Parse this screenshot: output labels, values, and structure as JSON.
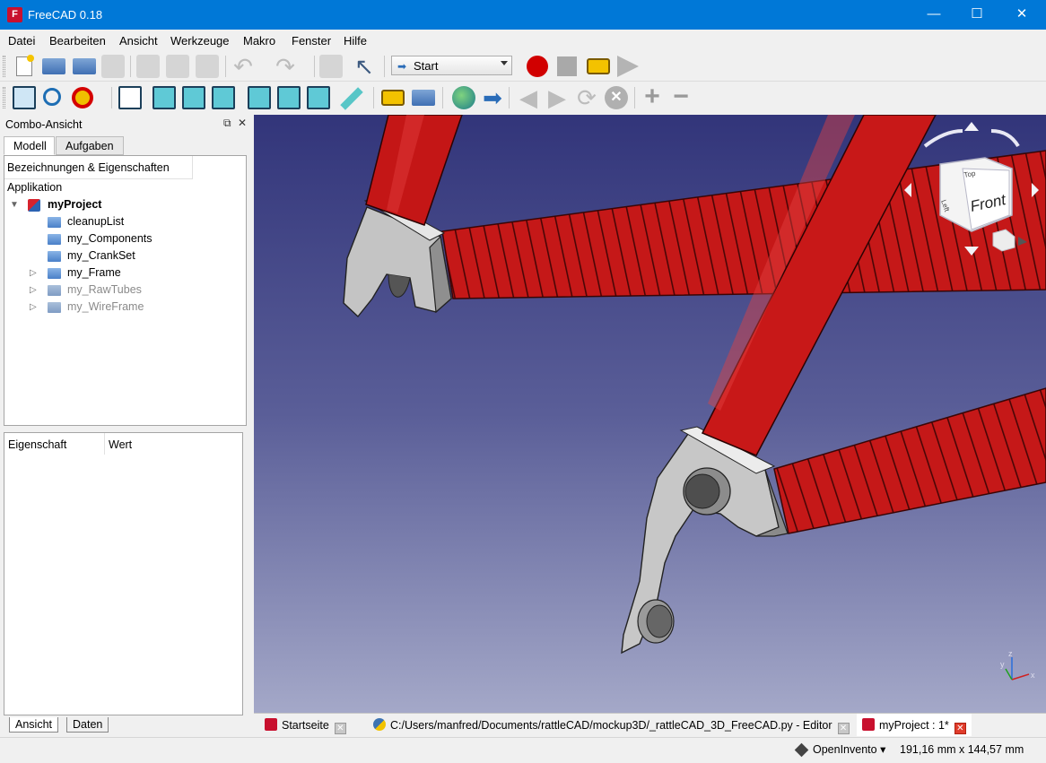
{
  "window": {
    "title": "FreeCAD 0.18",
    "app_icon": "freecad-icon",
    "minimize": "—",
    "maximize": "☐",
    "close": "✕"
  },
  "menu": [
    "Datei",
    "Bearbeiten",
    "Ansicht",
    "Werkzeuge",
    "Makro",
    "Fenster",
    "Hilfe"
  ],
  "workbench": {
    "selected": "Start"
  },
  "combo": {
    "title": "Combo-Ansicht",
    "tabs": [
      "Modell",
      "Aufgaben"
    ],
    "tree_header": "Bezeichnungen & Eigenschaften",
    "app_label": "Applikation",
    "project": "myProject",
    "items": [
      "cleanupList",
      "my_Components",
      "my_CrankSet",
      "my_Frame",
      "my_RawTubes",
      "my_WireFrame"
    ],
    "props_cols": [
      "Eigenschaft",
      "Wert"
    ],
    "bottom_tabs": [
      "Ansicht",
      "Daten"
    ]
  },
  "navcube": {
    "face": "Front",
    "top": "Top",
    "left": "Left"
  },
  "docs": [
    {
      "label": "Startseite",
      "icon": "freecad-icon"
    },
    {
      "label": "C:/Users/manfred/Documents/rattleCAD/mockup3D/_rattleCAD_3D_FreeCAD.py - Editor",
      "icon": "python-icon"
    },
    {
      "label": "myProject : 1*",
      "icon": "freecad-icon"
    }
  ],
  "status": {
    "navigation": "OpenInvento",
    "dimensions": "191,16 mm x 144,57 mm"
  },
  "colors": {
    "tube_red": "#c01a1a",
    "titlebar": "#0078d7",
    "dropout_gray": "#bdbdbd"
  }
}
